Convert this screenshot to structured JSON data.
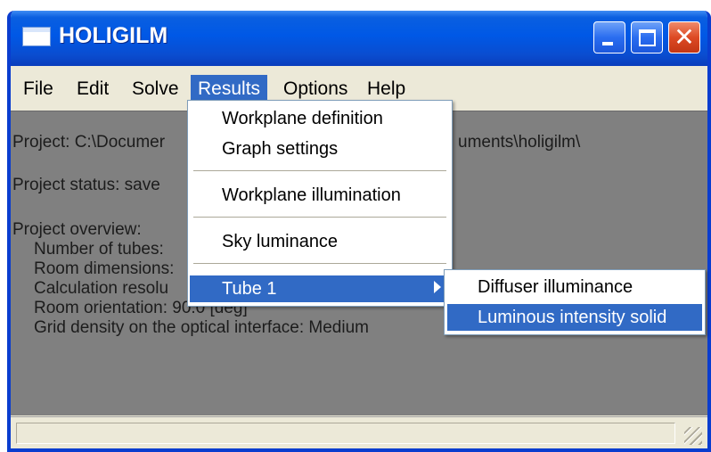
{
  "window": {
    "title": "HOLIGILM",
    "controls": {
      "minimize": "minimize-icon",
      "maximize": "maximize-icon",
      "close": "close-icon"
    }
  },
  "menubar": {
    "items": [
      {
        "label": "File"
      },
      {
        "label": "Edit"
      },
      {
        "label": "Solve"
      },
      {
        "label": "Results"
      },
      {
        "label": "Options"
      },
      {
        "label": "Help"
      }
    ],
    "active": "Results"
  },
  "content": {
    "project_prefix": "Project: C:\\Documer",
    "project_suffix": "uments\\holigilm\\",
    "status": "Project status: save",
    "overview_heading": "Project overview:",
    "overview": [
      "Number of tubes:",
      "Room dimensions:",
      "Calculation resolu",
      "Room orientation: 90.0 [deg]",
      "Grid density on the optical interface: Medium"
    ]
  },
  "results_menu": {
    "items": [
      {
        "label": "Workplane definition"
      },
      {
        "label": "Graph settings"
      },
      {
        "label": "Workplane illumination"
      },
      {
        "label": "Sky luminance"
      },
      {
        "label": "Tube 1"
      }
    ]
  },
  "tube_submenu": {
    "items": [
      {
        "label": "Diffuser illuminance"
      },
      {
        "label": "Luminous intensity solid"
      }
    ]
  },
  "colors": {
    "title_bar": "#0058e6",
    "menu_highlight": "#316ac5",
    "client_area": "#808080",
    "close_button": "#dd4a24"
  }
}
